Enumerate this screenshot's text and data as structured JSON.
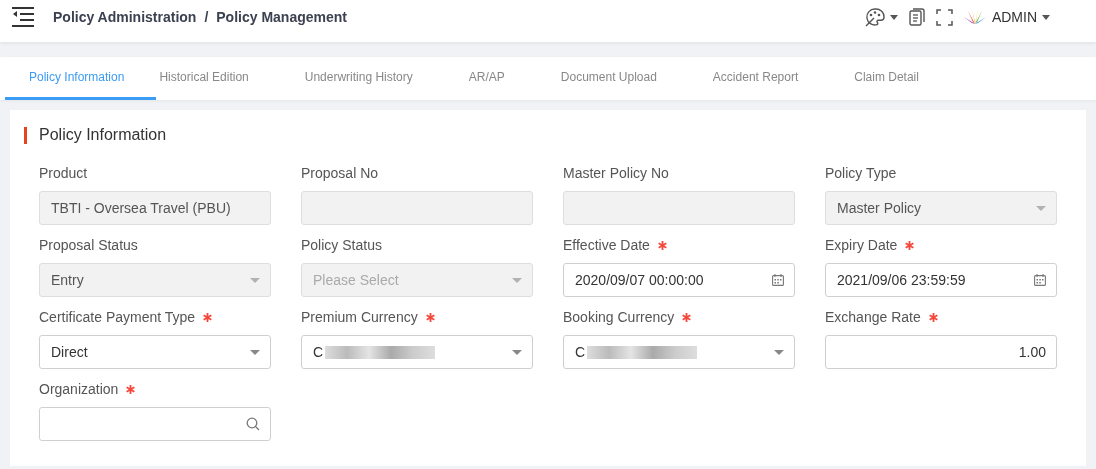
{
  "header": {
    "breadcrumb": [
      "Policy Administration",
      "Policy Management"
    ],
    "separator": "/",
    "user": "ADMIN"
  },
  "tabs": [
    {
      "label": "Policy Information",
      "selected": true
    },
    {
      "label": "Historical Edition",
      "selected": false
    },
    {
      "label": "Underwriting History",
      "selected": false
    },
    {
      "label": "AR/AP",
      "selected": false
    },
    {
      "label": "Document Upload",
      "selected": false
    },
    {
      "label": "Accident Report",
      "selected": false
    },
    {
      "label": "Claim Detail",
      "selected": false
    }
  ],
  "section": {
    "title": "Policy Information",
    "fields": [
      {
        "label": "Product",
        "kind": "text",
        "value": "TBTI - Oversea Travel (PBU)",
        "required": false,
        "disabled": true
      },
      {
        "label": "Proposal No",
        "kind": "text",
        "required": false,
        "disabled": true
      },
      {
        "label": "Master Policy No",
        "kind": "text",
        "required": false,
        "disabled": true
      },
      {
        "label": "Policy Type",
        "kind": "select",
        "value": "Master Policy",
        "required": false,
        "disabled": true
      },
      {
        "label": "Proposal Status",
        "kind": "select",
        "value": "Entry",
        "required": false,
        "disabled": true
      },
      {
        "label": "Policy Status",
        "kind": "select",
        "placeholder": "Please Select",
        "required": false,
        "disabled": true
      },
      {
        "label": "Effective Date",
        "kind": "date",
        "value": "2020/09/07 00:00:00",
        "required": true,
        "disabled": false
      },
      {
        "label": "Expiry Date",
        "kind": "date",
        "value": "2021/09/06 23:59:59",
        "required": true,
        "disabled": false
      },
      {
        "label": "Certificate Payment Type",
        "kind": "select",
        "value": "Direct",
        "required": true,
        "disabled": false
      },
      {
        "label": "Premium Currency",
        "kind": "select",
        "value": "C",
        "redacted": true,
        "required": true,
        "disabled": false
      },
      {
        "label": "Booking Currency",
        "kind": "select",
        "value": "C",
        "redacted": true,
        "required": true,
        "disabled": false
      },
      {
        "label": "Exchange Rate",
        "kind": "number",
        "value": "1.00",
        "required": true,
        "disabled": false
      },
      {
        "label": "Organization",
        "kind": "search",
        "required": true,
        "disabled": false
      }
    ]
  }
}
